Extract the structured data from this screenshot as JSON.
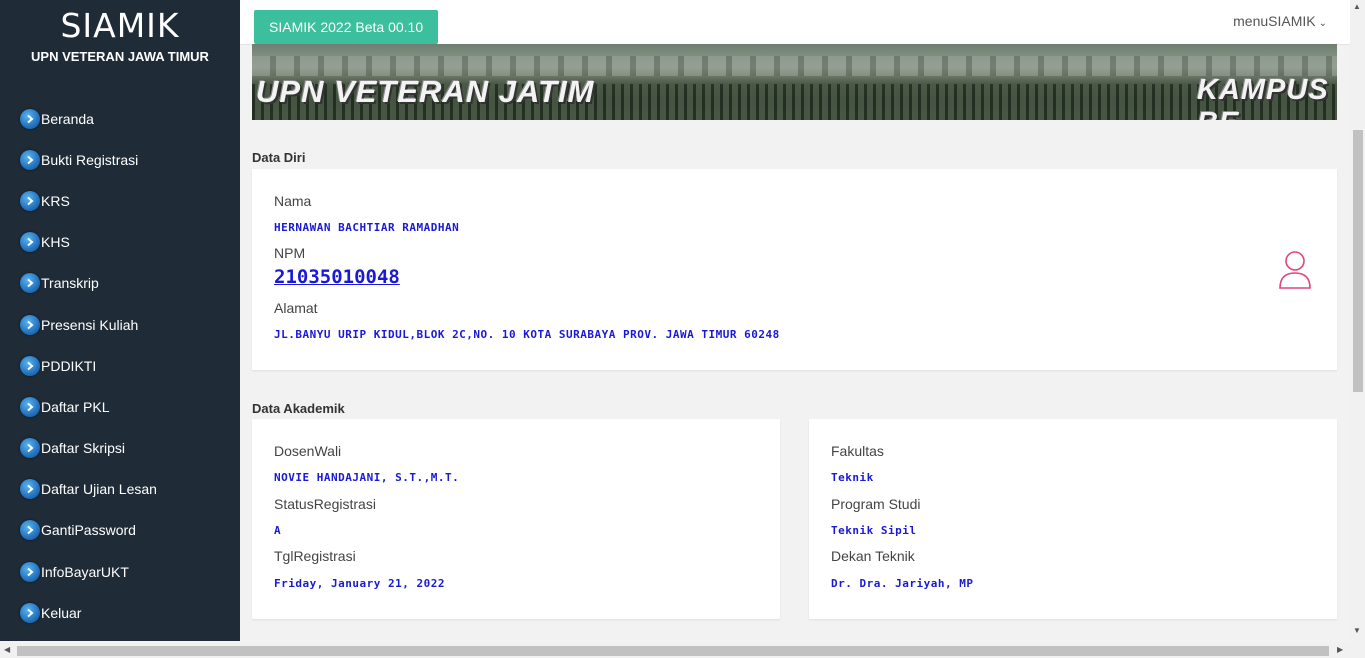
{
  "sidebar": {
    "title": "SIAMIK",
    "subtitle": "UPN VETERAN JAWA TIMUR",
    "items": [
      {
        "label": "Beranda"
      },
      {
        "label": "Bukti Registrasi"
      },
      {
        "label": "KRS"
      },
      {
        "label": "KHS"
      },
      {
        "label": "Transkrip"
      },
      {
        "label": "Presensi Kuliah"
      },
      {
        "label": "PDDIKTI"
      },
      {
        "label": "Daftar PKL"
      },
      {
        "label": "Daftar Skripsi"
      },
      {
        "label": "Daftar Ujian Lesan"
      },
      {
        "label": "GantiPassword"
      },
      {
        "label": "InfoBayarUKT"
      },
      {
        "label": "Keluar"
      }
    ]
  },
  "topbar": {
    "version_label": "SIAMIK 2022 Beta 00.10",
    "menu_label": "menuSIAMIK"
  },
  "banner": {
    "left_text": "UPN VETERAN JATIM",
    "right_text": "KAMPUS BE"
  },
  "data_diri": {
    "section_title": "Data Diri",
    "nama_label": "Nama",
    "nama_value": "HERNAWAN BACHTIAR RAMADHAN",
    "npm_label": "NPM",
    "npm_value": "21035010048",
    "alamat_label": "Alamat",
    "alamat_value": "JL.BANYU URIP KIDUL,BLOK 2C,NO. 10 KOTA SURABAYA PROV. JAWA TIMUR 60248"
  },
  "data_akademik": {
    "section_title": "Data Akademik",
    "dosen_wali_label": "DosenWali",
    "dosen_wali_value": "NOVIE HANDAJANI, S.T.,M.T.",
    "status_label": "StatusRegistrasi",
    "status_value": "A",
    "tgl_label": "TglRegistrasi",
    "tgl_value": "Friday, January 21, 2022",
    "fakultas_label": "Fakultas",
    "fakultas_value": "Teknik",
    "prodi_label": "Program Studi",
    "prodi_value": "Teknik Sipil",
    "dekan_label": "Dekan Teknik",
    "dekan_value": "Dr. Dra. Jariyah, MP"
  },
  "colors": {
    "sidebar_bg": "#1f2b36",
    "accent_button": "#3bbf9c",
    "value_text": "#1a1ad6",
    "avatar_icon": "#e0457b"
  }
}
